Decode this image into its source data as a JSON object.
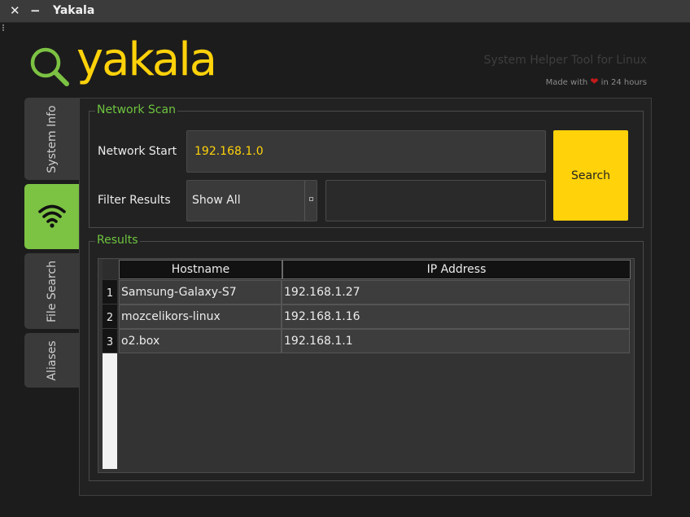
{
  "window": {
    "title": "Yakala",
    "close_glyph": "✕",
    "minimize_glyph": "−"
  },
  "header": {
    "logo_text": "yakala",
    "tagline": "System Helper Tool for Linux",
    "made_with_prefix": "Made with",
    "made_with_suffix": "in 24 hours"
  },
  "tabs": [
    {
      "label": "System Info",
      "icon": "none",
      "active": false
    },
    {
      "label": "",
      "icon": "wifi-icon",
      "active": true
    },
    {
      "label": "File Search",
      "icon": "none",
      "active": false
    },
    {
      "label": "Aliases",
      "icon": "none",
      "active": false
    }
  ],
  "network_scan": {
    "group_title": "Network Scan",
    "network_start_label": "Network Start",
    "network_start_value": "192.168.1.0",
    "filter_label": "Filter Results",
    "filter_selected": "Show All",
    "filter_text": "",
    "search_label": "Search"
  },
  "results": {
    "group_title": "Results",
    "columns": [
      "Hostname",
      "IP Address"
    ],
    "rows": [
      {
        "num": "1",
        "hostname": "Samsung-Galaxy-S7",
        "ip": "192.168.1.27"
      },
      {
        "num": "2",
        "hostname": "mozcelikors-linux",
        "ip": "192.168.1.16"
      },
      {
        "num": "3",
        "hostname": "o2.box",
        "ip": "192.168.1.1"
      }
    ]
  },
  "colors": {
    "accent_yellow": "#ffd20a",
    "accent_green": "#7cc243",
    "group_title_green": "#6ec43f",
    "heart_red": "#c41a1a"
  }
}
